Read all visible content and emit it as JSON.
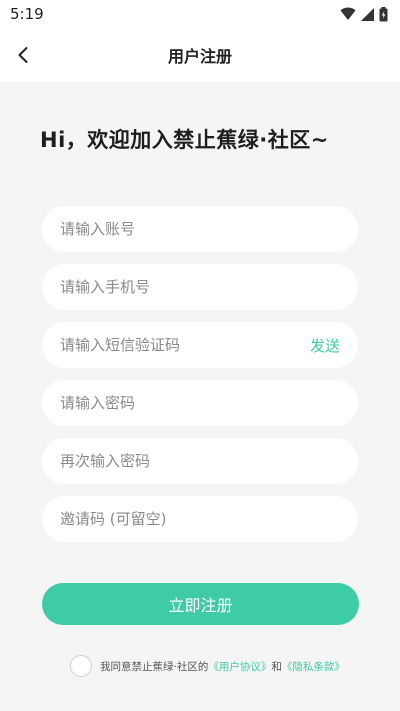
{
  "status_bar": {
    "time": "5:19",
    "icons": [
      "wifi-icon",
      "cell-signal-icon",
      "battery-icon"
    ]
  },
  "nav": {
    "back_icon": "chevron-left-icon",
    "title": "用户注册"
  },
  "greeting": "Hi，欢迎加入禁止蕉绿·社区~",
  "form": {
    "account_placeholder": "请输入账号",
    "phone_placeholder": "请输入手机号",
    "sms_code_placeholder": "请输入短信验证码",
    "send_label": "发送",
    "password_placeholder": "请输入密码",
    "confirm_password_placeholder": "再次输入密码",
    "invite_code_placeholder": "邀请码 (可留空)"
  },
  "register_button": "立即注册",
  "agreement": {
    "prefix": "我同意禁止蕉绿·社区的",
    "user_agreement": "《用户协议》",
    "conjunction": "和",
    "privacy_policy": "《隐私条款》",
    "checked": false
  },
  "colors": {
    "accent": "#3ecba5",
    "background": "#f5f5f5",
    "field_background": "#ffffff"
  }
}
